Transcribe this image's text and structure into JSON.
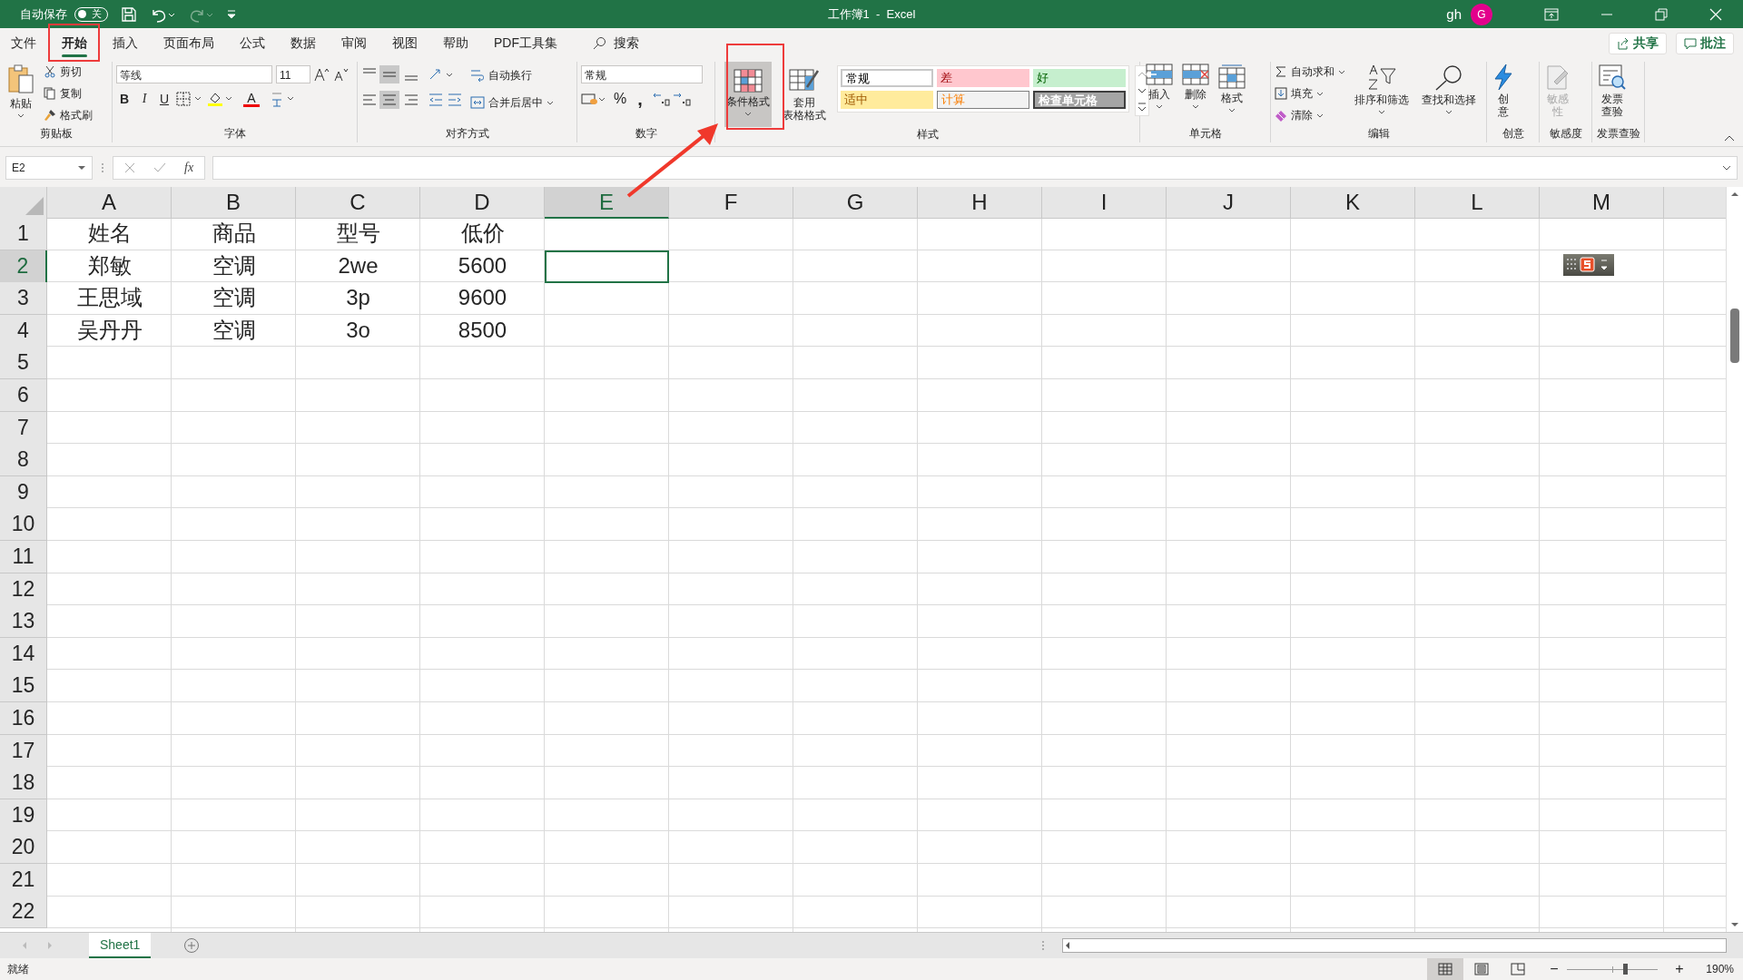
{
  "title_bar": {
    "autosave_label": "自动保存",
    "autosave": {
      "on": false,
      "label": "关"
    },
    "title": "工作簿1  -  Excel",
    "user": "gh",
    "avatar": "G"
  },
  "menu_tabs": [
    {
      "label": "文件",
      "selected": false
    },
    {
      "label": "开始",
      "selected": true
    },
    {
      "label": "插入",
      "selected": false
    },
    {
      "label": "页面布局",
      "selected": false
    },
    {
      "label": "公式",
      "selected": false
    },
    {
      "label": "数据",
      "selected": false
    },
    {
      "label": "审阅",
      "selected": false
    },
    {
      "label": "视图",
      "selected": false
    },
    {
      "label": "帮助",
      "selected": false
    },
    {
      "label": "PDF工具集",
      "selected": false
    }
  ],
  "search": "搜索",
  "share": "共享",
  "comments": "批注",
  "ribbon": {
    "clipboard": {
      "paste": "粘贴",
      "cut": "剪切",
      "copy": "复制",
      "format_painter": "格式刷",
      "label": "剪贴板"
    },
    "font": {
      "name": "等线",
      "size": "11",
      "bold": "B",
      "italic": "I",
      "underline": "U",
      "font_color": "A",
      "label": "字体"
    },
    "alignment": {
      "wrap": "自动换行",
      "merge": "合并后居中",
      "label": "对齐方式"
    },
    "number": {
      "format": "常规",
      "percent": "%",
      "comma": ",",
      "label": "数字"
    },
    "styles": {
      "conditional": "条件格式",
      "table": [
        "套用",
        "表格格式"
      ],
      "gallery": [
        {
          "kind": "normal",
          "label": "常规"
        },
        {
          "kind": "bad",
          "label": "差"
        },
        {
          "kind": "good",
          "label": "好"
        },
        {
          "kind": "neutral",
          "label": "适中"
        },
        {
          "kind": "calculation",
          "label": "计算"
        },
        {
          "kind": "check",
          "label": "检查单元格"
        }
      ],
      "label": "样式"
    },
    "cells": {
      "insert": "插入",
      "delete": "删除",
      "format": "格式",
      "label": "单元格"
    },
    "editing": {
      "autosum": "自动求和",
      "fill": "填充",
      "clear": "清除",
      "sort": "排序和筛选",
      "find": "查找和选择",
      "label": "编辑"
    },
    "ideas": {
      "button": [
        "创",
        "意"
      ],
      "label": "创意"
    },
    "sensitivity": {
      "button": [
        "敏感",
        "性"
      ],
      "disabled": true,
      "label": "敏感度"
    },
    "invoice": {
      "button": [
        "发票",
        "查验"
      ],
      "label": "发票查验"
    }
  },
  "formula_bar": {
    "name_box": "E2",
    "fx": "fx"
  },
  "sheet": {
    "columns": [
      {
        "label": "A",
        "selected": false
      },
      {
        "label": "B",
        "selected": false
      },
      {
        "label": "C",
        "selected": false
      },
      {
        "label": "D",
        "selected": false
      },
      {
        "label": "E",
        "selected": true
      },
      {
        "label": "F",
        "selected": false
      },
      {
        "label": "G",
        "selected": false
      },
      {
        "label": "H",
        "selected": false
      },
      {
        "label": "I",
        "selected": false
      },
      {
        "label": "J",
        "selected": false
      },
      {
        "label": "K",
        "selected": false
      },
      {
        "label": "L",
        "selected": false
      },
      {
        "label": "M",
        "selected": false
      }
    ],
    "rows": [
      {
        "number": "1",
        "selected": false,
        "cells": [
          "姓名",
          "商品",
          "型号",
          "低价"
        ]
      },
      {
        "number": "2",
        "selected": true,
        "cells": [
          "郑敏",
          "空调",
          "2we",
          "5600"
        ]
      },
      {
        "number": "3",
        "selected": false,
        "cells": [
          "王思域",
          "空调",
          "3p",
          "9600"
        ]
      },
      {
        "number": "4",
        "selected": false,
        "cells": [
          "吴丹丹",
          "空调",
          "3o",
          "8500"
        ]
      },
      {
        "number": "5",
        "selected": false
      },
      {
        "number": "6",
        "selected": false
      },
      {
        "number": "7",
        "selected": false
      },
      {
        "number": "8",
        "selected": false
      },
      {
        "number": "9",
        "selected": false
      },
      {
        "number": "10",
        "selected": false
      },
      {
        "number": "11",
        "selected": false
      },
      {
        "number": "12",
        "selected": false
      },
      {
        "number": "13",
        "selected": false
      },
      {
        "number": "14",
        "selected": false
      },
      {
        "number": "15",
        "selected": false
      },
      {
        "number": "16",
        "selected": false
      },
      {
        "number": "17",
        "selected": false
      },
      {
        "number": "18",
        "selected": false
      },
      {
        "number": "19",
        "selected": false
      },
      {
        "number": "20",
        "selected": false
      },
      {
        "number": "21",
        "selected": false
      },
      {
        "number": "22",
        "selected": false
      }
    ]
  },
  "sheet_tabs": [
    {
      "label": "Sheet1",
      "selected": true
    }
  ],
  "status_bar": {
    "status": "就绪",
    "views": [
      {
        "kind": "normal",
        "selected": true
      },
      {
        "kind": "page_layout",
        "selected": false
      },
      {
        "kind": "page_break",
        "selected": false
      }
    ],
    "zoom": {
      "minus": "−",
      "plus": "+",
      "level": 0.64,
      "reading": "190%"
    }
  }
}
